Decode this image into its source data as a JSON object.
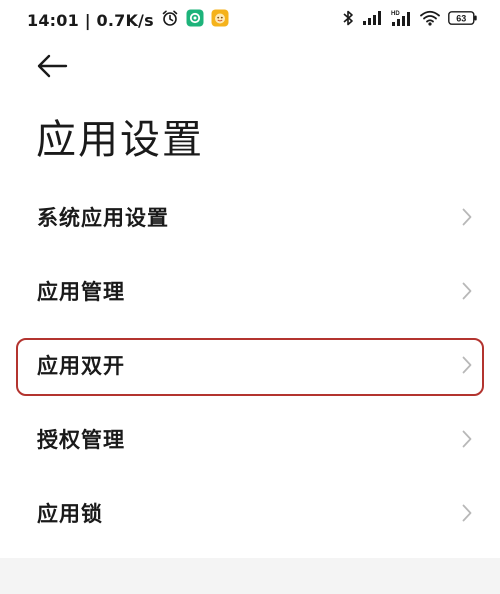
{
  "status_bar": {
    "time_speed": "14:01 | 0.7K/s",
    "battery_level": "63",
    "icons": [
      "alarm-icon",
      "app-green-icon",
      "app-yellow-icon",
      "bluetooth-icon",
      "signal-icon",
      "hd-signal-icon",
      "wifi-icon",
      "battery-icon"
    ]
  },
  "header": {
    "back_icon": "back-arrow-icon",
    "title": "应用设置"
  },
  "menu": {
    "items": [
      {
        "label": "系统应用设置"
      },
      {
        "label": "应用管理"
      },
      {
        "label": "应用双开",
        "highlighted": true
      },
      {
        "label": "授权管理"
      },
      {
        "label": "应用锁"
      }
    ]
  },
  "colors": {
    "highlight_border": "#b3342f",
    "chevron": "#b8b8b8",
    "app_green": "#1db37a",
    "app_yellow": "#f5b21b"
  }
}
